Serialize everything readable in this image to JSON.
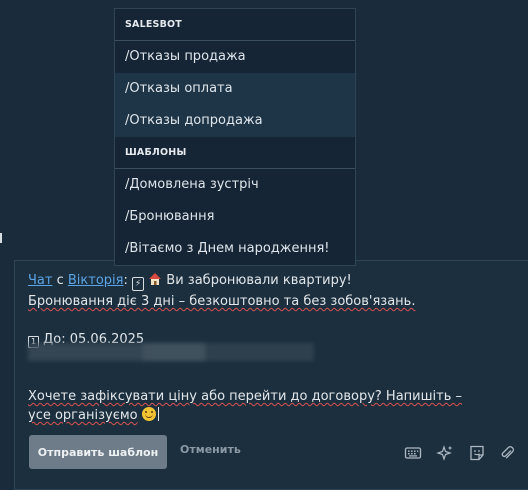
{
  "dropdown": {
    "sections": [
      {
        "title": "SALESBOT",
        "items": [
          "/Отказы продажа",
          "/Отказы оплата",
          "/Отказы допродажа"
        ]
      },
      {
        "title": "ШАБЛОНЫ",
        "items": [
          "/Домовлена зустріч",
          "/Бронювання",
          "/Вітаємо з Днем народження!"
        ]
      }
    ]
  },
  "message": {
    "chat_link": "Чат",
    "with": "с",
    "person": "Вікторія",
    "colon": ":",
    "line1_text": "Ви забронювали квартиру!",
    "line2": "Бронювання діє 3 дні – безкоштовно та без зобов'язань.",
    "date_label": "До: 05.06.2025",
    "line4": "Хочете зафіксувати ціну або перейти до договору? Напишіть – усе організуємо"
  },
  "actions": {
    "send_label": "Отправить шаблон",
    "cancel_label": "Отменить"
  },
  "colors": {
    "background": "#1a2c3b",
    "link": "#5ba4e5",
    "button": "#6d7c88"
  }
}
